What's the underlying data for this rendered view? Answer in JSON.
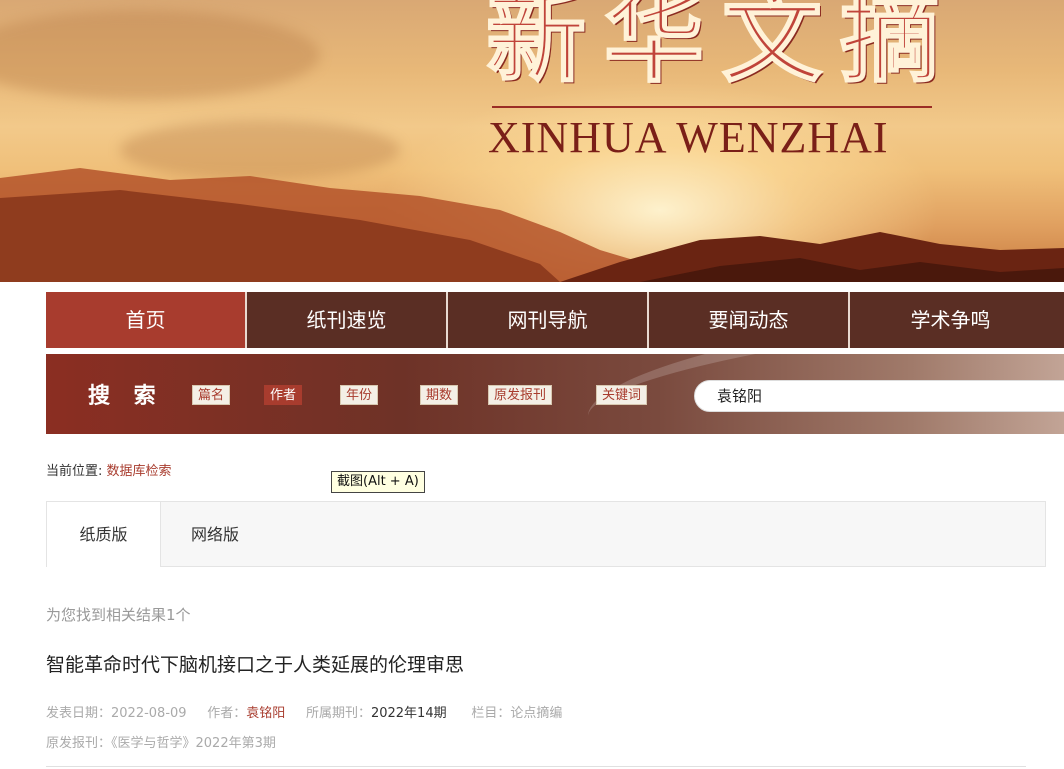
{
  "banner": {
    "logo_cn": "新华文摘",
    "logo_en": "XINHUA WENZHAI"
  },
  "nav": {
    "items": [
      {
        "label": "首页",
        "active": true
      },
      {
        "label": "纸刊速览"
      },
      {
        "label": "网刊导航"
      },
      {
        "label": "要闻动态"
      },
      {
        "label": "学术争鸣"
      }
    ]
  },
  "search": {
    "title": "搜 索",
    "fields": [
      "篇名",
      "作者",
      "年份",
      "期数",
      "原发报刊",
      "关键词"
    ],
    "active_field": "作者",
    "query": "袁铭阳"
  },
  "breadcrumb": {
    "prefix": "当前位置:",
    "link": "数据库检索"
  },
  "tooltip": "截图(Alt + A)",
  "tabs": [
    "纸质版",
    "网络版"
  ],
  "results": {
    "count_text": "为您找到相关结果1个",
    "items": [
      {
        "title": "智能革命时代下脑机接口之于人类延展的伦理审思",
        "date_label": "发表日期：",
        "date": "2022-08-09",
        "author_label": "作者：",
        "author": "袁铭阳",
        "issue_label": "所属期刊：",
        "issue": "2022年14期",
        "column_label": "栏目：",
        "column": "论点摘编",
        "source_label": "原发报刊：",
        "source": "《医学与哲学》2022年第3期"
      }
    ]
  },
  "colors": {
    "accent": "#a83c2e",
    "nav_bg": "#5a2e24"
  }
}
